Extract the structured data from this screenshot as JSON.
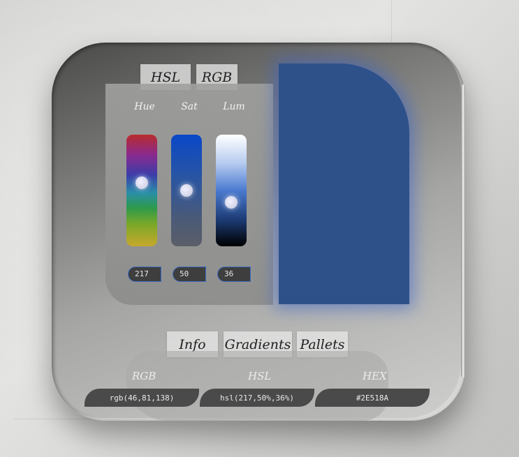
{
  "mode_tabs": [
    {
      "label": "HSL"
    },
    {
      "label": "RGB"
    }
  ],
  "sliders": {
    "hue": {
      "label": "Hue",
      "value": "217",
      "level": 0.42
    },
    "sat": {
      "label": "Sat",
      "value": "50",
      "level": 0.5
    },
    "lum": {
      "label": "Lum",
      "value": "36",
      "level": 0.62
    }
  },
  "preview": {
    "color": "#2E518A"
  },
  "bottom_tabs": [
    {
      "label": "Info"
    },
    {
      "label": "Gradients"
    },
    {
      "label": "Pallets"
    }
  ],
  "info": {
    "rgb": {
      "label": "RGB",
      "value": "rgb(46,81,138)"
    },
    "hsl": {
      "label": "HSL",
      "value": "hsl(217,50%,36%)"
    },
    "hex": {
      "label": "HEX",
      "value": "#2E518A"
    }
  }
}
